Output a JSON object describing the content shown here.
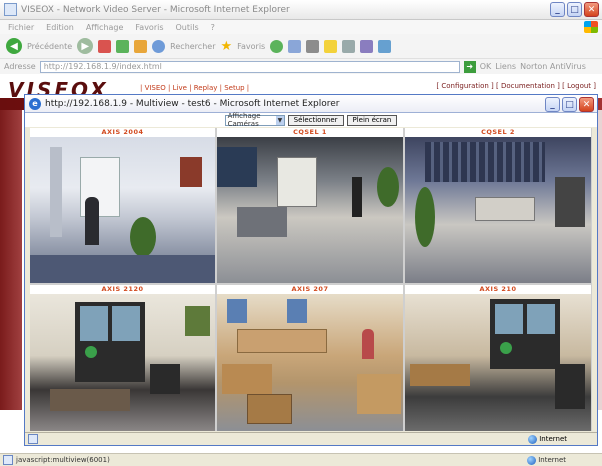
{
  "outer_window": {
    "title": "VISEOX - Network Video Server - Microsoft Internet Explorer",
    "controls": {
      "minimize": "_",
      "maximize": "□",
      "close": "✕"
    }
  },
  "menubar": {
    "items": [
      "Fichier",
      "Edition",
      "Affichage",
      "Favoris",
      "Outils",
      "?"
    ]
  },
  "toolbar": {
    "back_label": "Précédente",
    "search_label": "Rechercher",
    "favorites_label": "Favoris"
  },
  "addressbar": {
    "label": "Adresse",
    "url": "http://192.168.1.9/index.html",
    "go_label": "OK",
    "links_label": "Liens",
    "extra_label": "Norton AntiVirus"
  },
  "page": {
    "logo": "VISEOX",
    "nav_red": "| VISEO | Live | Replay | Setup |",
    "links": "[ Configuration ] [ Documentation ] [ Logout ]"
  },
  "popup": {
    "title": "http://192.168.1.9 - Multiview - test6 - Microsoft Internet Explorer",
    "viewer": {
      "select_value": "Affichage Caméras",
      "button_1": "Sélectionner",
      "button_2": "Plein écran"
    },
    "cameras": [
      {
        "label": "AXIS 2004"
      },
      {
        "label": "CQSEL 1"
      },
      {
        "label": "CQSEL 2"
      },
      {
        "label": "AXIS 2120"
      },
      {
        "label": "AXIS 207"
      },
      {
        "label": "AXIS 210"
      }
    ],
    "status": {
      "zone": "Internet"
    }
  },
  "statusbar": {
    "text": "javascript:multiview(6001)",
    "zone": "Internet"
  }
}
